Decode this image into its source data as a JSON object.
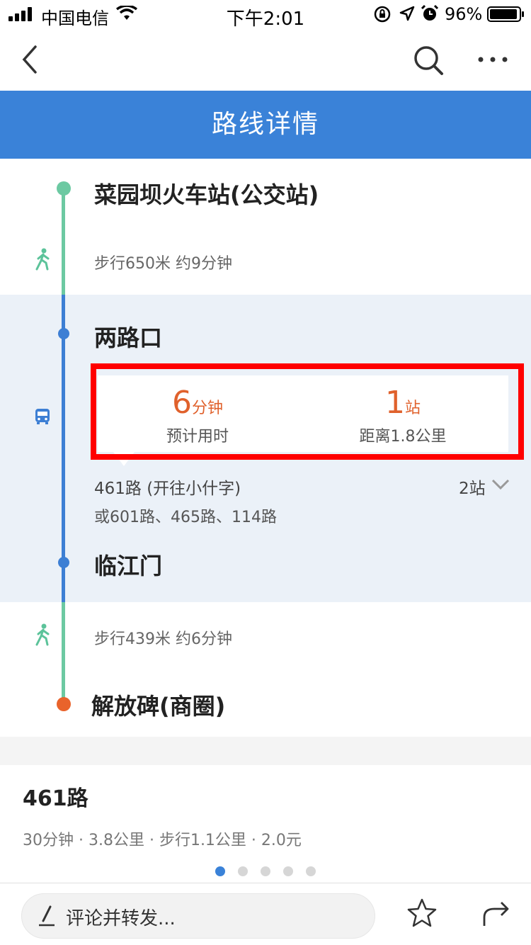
{
  "status_bar": {
    "carrier": "中国电信",
    "time": "下午2:01",
    "battery": "96%"
  },
  "header": {
    "title": "路线详情"
  },
  "route": {
    "origin": "菜园坝火车站(公交站)",
    "walk1": "步行650米 约9分钟",
    "board_stop": "两路口",
    "duration_value": "6",
    "duration_unit": "分钟",
    "duration_label": "预计用时",
    "stops_value": "1",
    "stops_unit": "站",
    "distance_label": "距离1.8公里",
    "line_name": "461路 (开往小什字)",
    "stop_count": "2站",
    "alternatives": "或601路、465路、114路",
    "alight_stop": "临江门",
    "walk2": "步行439米 约6分钟",
    "destination": "解放碑(商圈)"
  },
  "summary": {
    "title": "461路",
    "details": "30分钟 · 3.8公里 · 步行1.1公里 · 2.0元"
  },
  "pager": {
    "count": 5,
    "active": 0
  },
  "bottom_bar": {
    "comment_placeholder": "评论并转发..."
  },
  "colors": {
    "accent": "#3a82d8",
    "walk_green": "#6cc9a2",
    "orange": "#e0612c",
    "highlight": "#ff0000"
  }
}
